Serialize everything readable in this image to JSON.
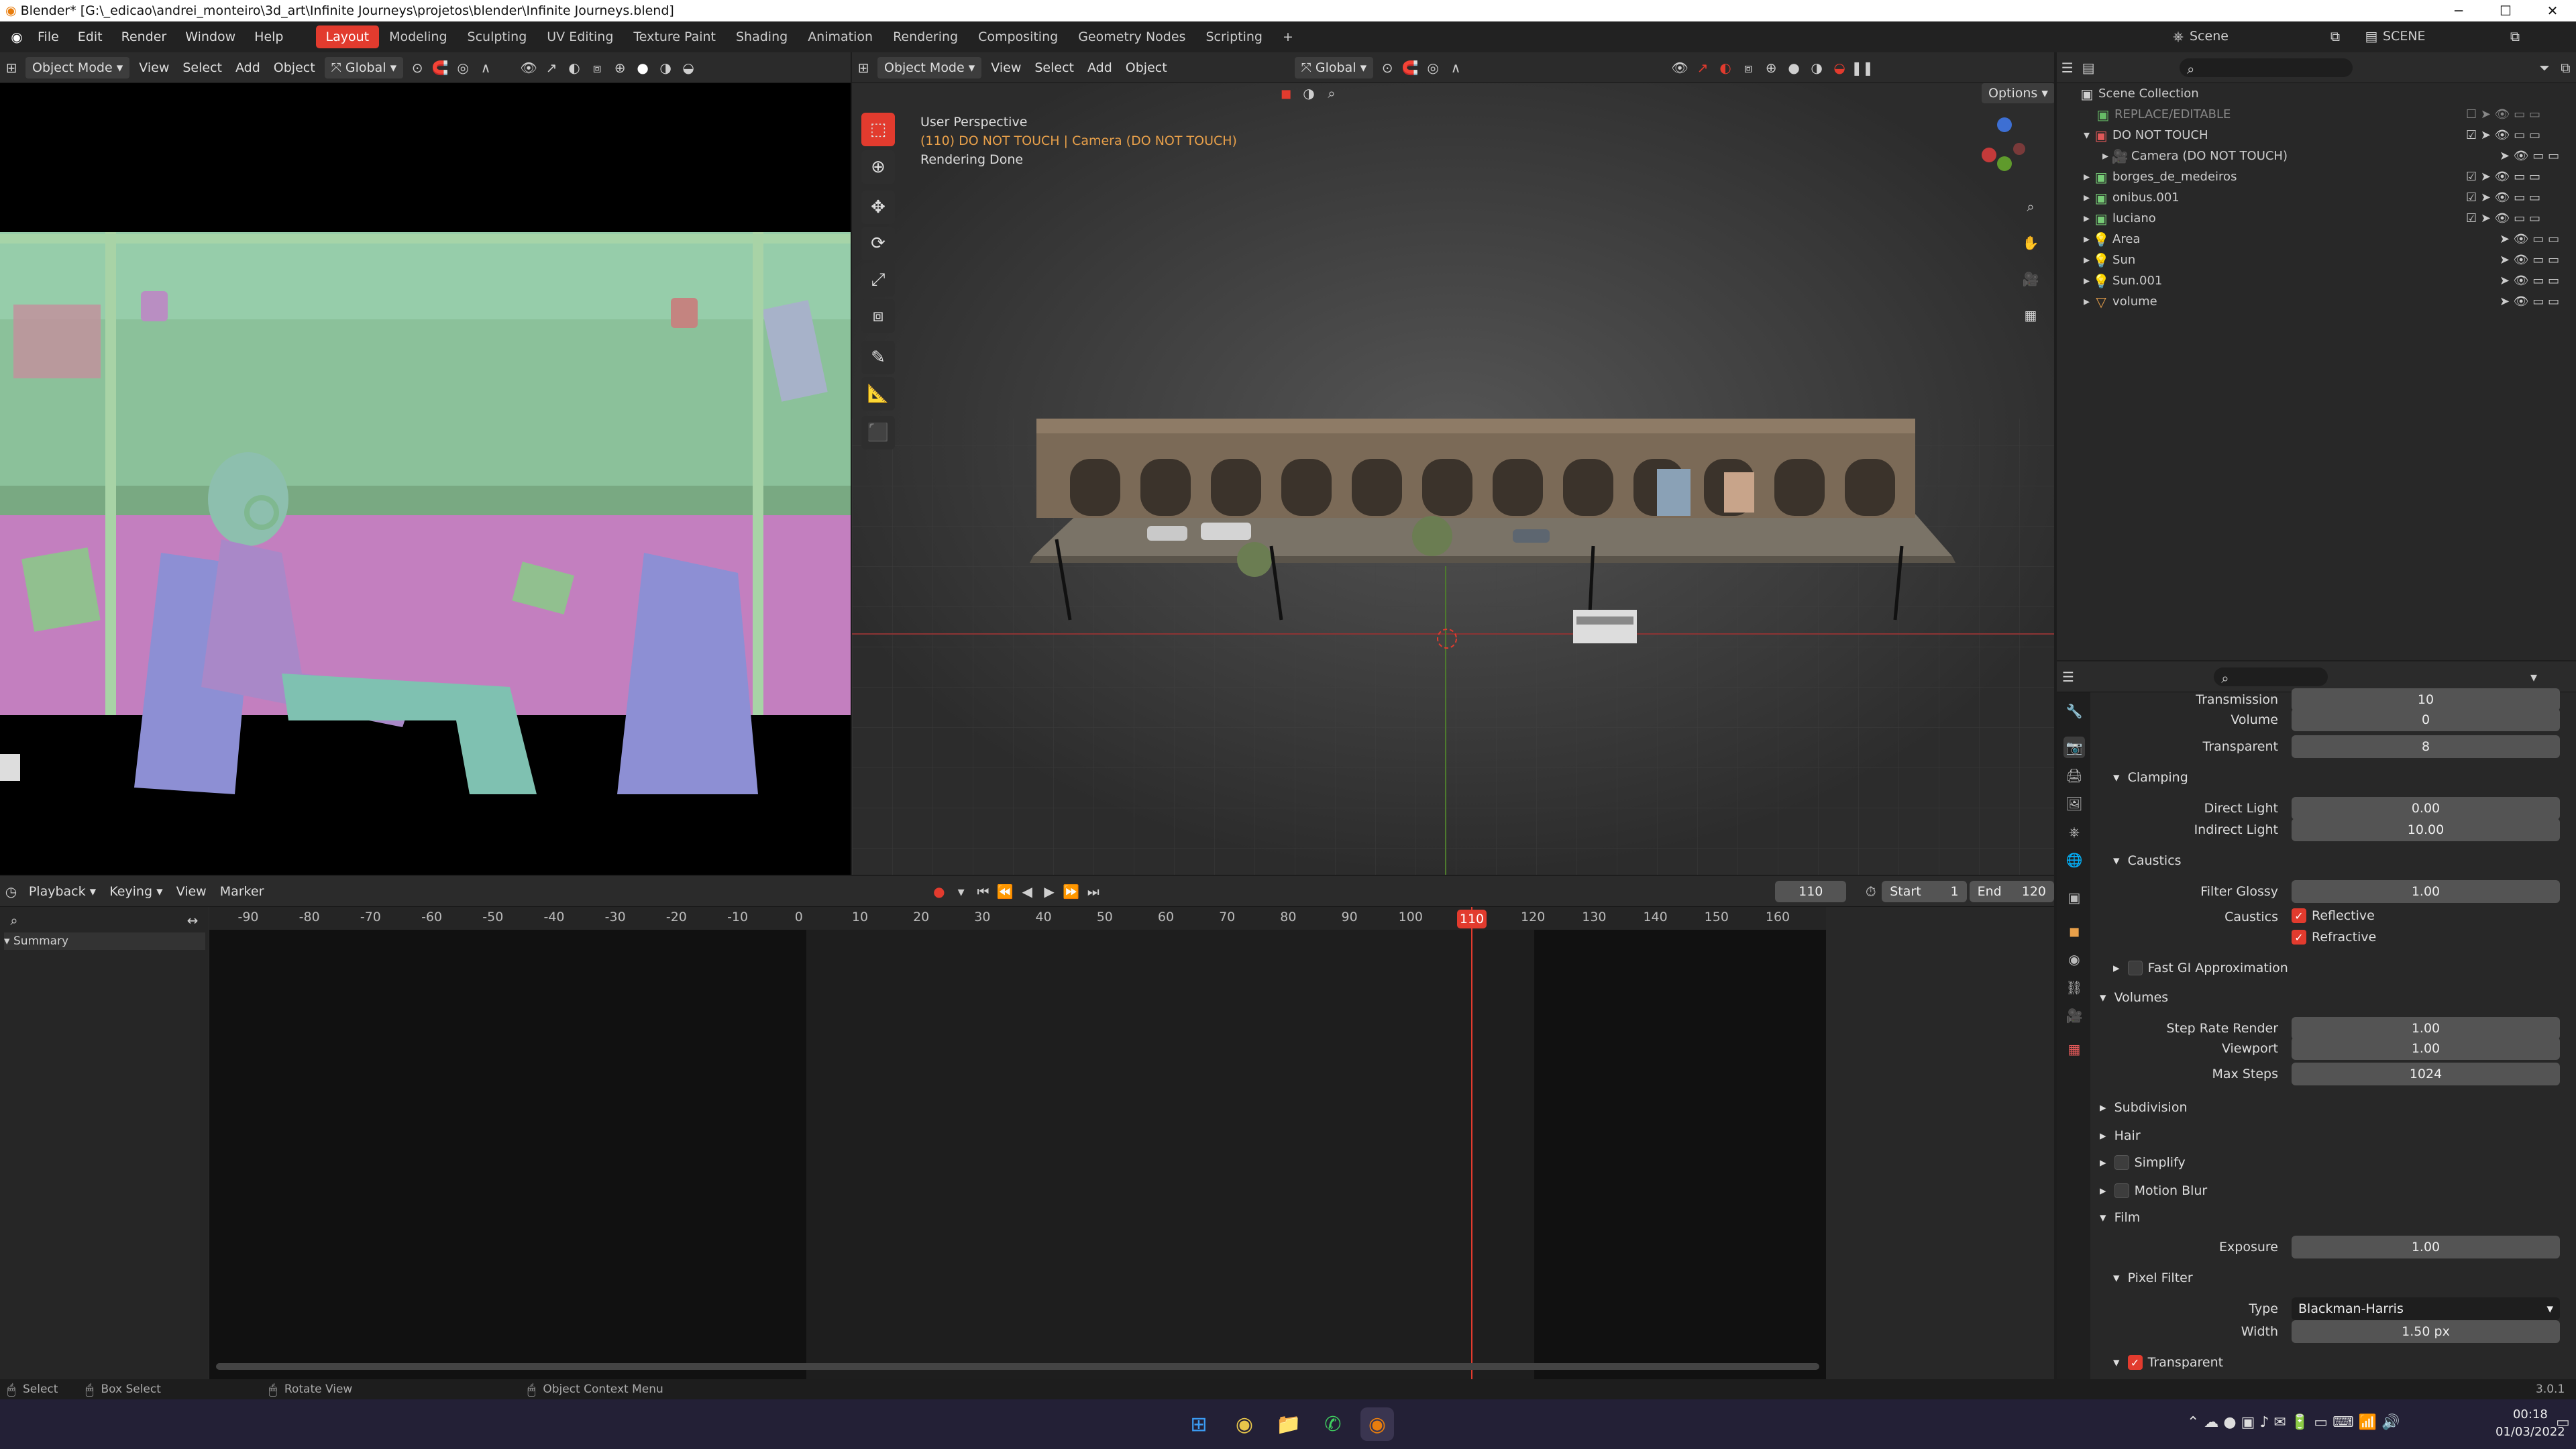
{
  "window": {
    "title": "Blender* [G:\\_edicao\\andrei_monteiro\\3d_art\\Infinite Journeys\\projetos\\blender\\Infinite Journeys.blend]",
    "min": "─",
    "max": "☐",
    "close": "✕"
  },
  "menu": [
    "File",
    "Edit",
    "Render",
    "Window",
    "Help"
  ],
  "workspaces": [
    "Layout",
    "Modeling",
    "Sculpting",
    "UV Editing",
    "Texture Paint",
    "Shading",
    "Animation",
    "Rendering",
    "Compositing",
    "Geometry Nodes",
    "Scripting"
  ],
  "add_workspace": "+",
  "scene": {
    "name": "Scene",
    "view_layer": "SCENE"
  },
  "cam_header": {
    "mode": "Object Mode",
    "view": "View",
    "select": "Select",
    "add": "Add",
    "object": "Object",
    "orient": "Global"
  },
  "vp_header": {
    "mode": "Object Mode",
    "view": "View",
    "select": "Select",
    "add": "Add",
    "object": "Object",
    "orient": "Global",
    "options": "Options"
  },
  "overlay": {
    "line1": "User Perspective",
    "line2": "(110) DO NOT TOUCH | Camera (DO NOT TOUCH)",
    "line3": "Rendering Done"
  },
  "outliner": {
    "root": "Scene Collection",
    "items": [
      {
        "label": "REPLACE/EDITABLE",
        "dim": true
      },
      {
        "label": "DO NOT TOUCH"
      },
      {
        "label": "Camera (DO NOT TOUCH)"
      },
      {
        "label": "borges_de_medeiros"
      },
      {
        "label": "onibus.001"
      },
      {
        "label": "luciano"
      },
      {
        "label": "Area"
      },
      {
        "label": "Sun"
      },
      {
        "label": "Sun.001"
      },
      {
        "label": "volume"
      }
    ]
  },
  "props": {
    "rows": [
      {
        "label": "Transmission",
        "value": "10"
      },
      {
        "label": "Volume",
        "value": "0"
      },
      {
        "label": "Transparent",
        "value": "8"
      }
    ],
    "clamping": {
      "title": "Clamping",
      "direct_label": "Direct Light",
      "direct": "0.00",
      "indirect_label": "Indirect Light",
      "indirect": "10.00"
    },
    "caustics": {
      "title": "Caustics",
      "glossy_label": "Filter Glossy",
      "glossy": "1.00",
      "label": "Caustics",
      "reflective": "Reflective",
      "refractive": "Refractive"
    },
    "fast_gi": "Fast GI Approximation",
    "volumes": {
      "title": "Volumes",
      "step_label": "Step Rate Render",
      "step": "1.00",
      "viewport_label": "Viewport",
      "viewport": "1.00",
      "max_label": "Max Steps",
      "max": "1024"
    },
    "subdivision": "Subdivision",
    "hair": "Hair",
    "simplify": "Simplify",
    "motion_blur": "Motion Blur",
    "film": {
      "title": "Film",
      "exposure_label": "Exposure",
      "exposure": "1.00"
    },
    "pixel_filter": {
      "title": "Pixel Filter",
      "type_label": "Type",
      "type": "Blackman-Harris",
      "width_label": "Width",
      "width": "1.50 px"
    },
    "transparent": "Transparent"
  },
  "timeline": {
    "playback": "Playback",
    "keying": "Keying",
    "view": "View",
    "marker": "Marker",
    "current": "110",
    "start_label": "Start",
    "start": "1",
    "end_label": "End",
    "end": "120",
    "summary": "Summary",
    "ticks": [
      "-90",
      "-80",
      "-70",
      "-60",
      "-50",
      "-40",
      "-30",
      "-20",
      "-10",
      "0",
      "10",
      "20",
      "30",
      "40",
      "50",
      "60",
      "70",
      "80",
      "90",
      "100",
      "110",
      "120",
      "130",
      "140",
      "150",
      "160"
    ]
  },
  "status": {
    "select": "Select",
    "box": "Box Select",
    "rotate": "Rotate View",
    "context": "Object Context Menu",
    "version": "3.0.1"
  },
  "taskbar": {
    "time": "00:18",
    "date": "01/03/2022"
  },
  "colors": {
    "accent": "#e23b2e",
    "outliner_orange": "#e8a04a",
    "collection_white": "#cfcfcf"
  }
}
